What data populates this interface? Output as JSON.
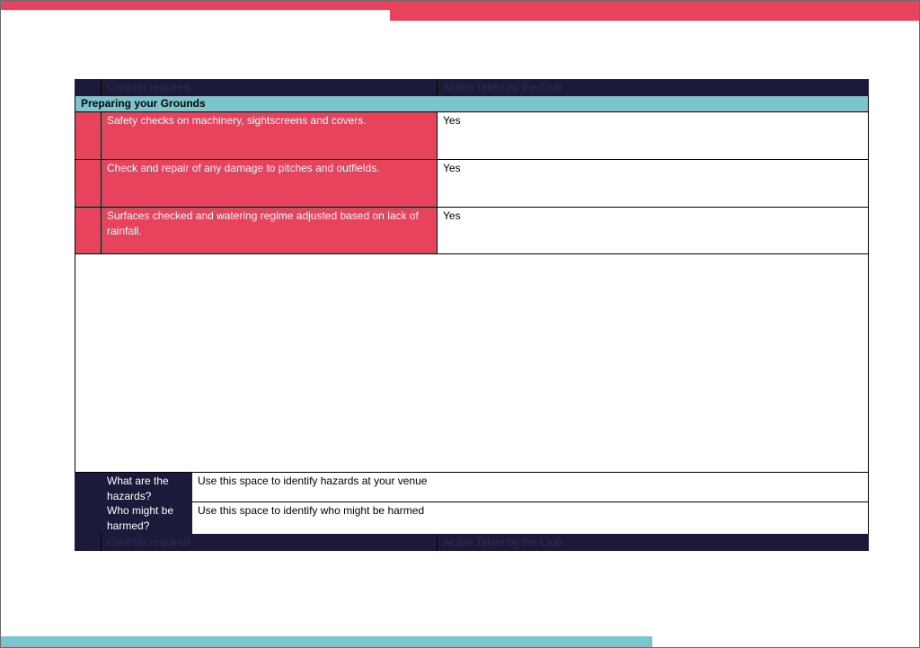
{
  "table": {
    "header_top": {
      "controls_label": "Controls required",
      "action_label": "Action Taken by the Club"
    },
    "section_title": "Preparing your Grounds",
    "rows": [
      {
        "control": "Safety checks on machinery, sightscreens and covers.",
        "action": "Yes"
      },
      {
        "control": "Check and repair of any damage to pitches and outfields.",
        "action": "Yes"
      },
      {
        "control": "Surfaces checked and watering regime adjusted based on lack of rainfall.",
        "action": "Yes"
      }
    ],
    "hazards": {
      "label": "What are the hazards?",
      "value": "Use this space to identify hazards at your venue"
    },
    "harmed": {
      "label": "Who might be harmed?",
      "value": "Use this space to identify who might be harmed"
    },
    "header_bottom": {
      "controls_label": "Controls required",
      "action_label": "Action Taken by the Club"
    }
  },
  "colors": {
    "accent_pink": "#e8435d",
    "accent_teal": "#7bc6cc",
    "navy": "#1b1a3a"
  }
}
